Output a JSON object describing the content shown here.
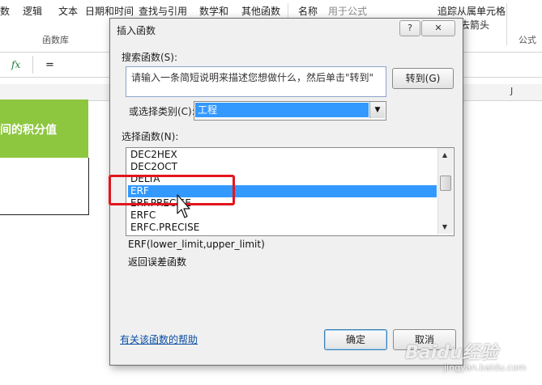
{
  "ribbon": {
    "items": [
      {
        "label": "数"
      },
      {
        "label": "逻辑"
      },
      {
        "label": "文本"
      },
      {
        "label": "日期和时间"
      },
      {
        "label": "查找与引用"
      },
      {
        "label": "数学和"
      },
      {
        "label": "其他函数"
      },
      {
        "label": "名称"
      },
      {
        "label": "用于公式"
      },
      {
        "label": "追踪从属单元格"
      }
    ],
    "group_label": "函数库",
    "right_group_label": "公式",
    "partial_right_label": "移去箭头"
  },
  "formula_bar": {
    "fx": "fx",
    "content": "="
  },
  "columns": {
    "right_header": "J"
  },
  "sheet": {
    "cell_text": "间的积分值",
    "cell_color": "#8dc63f"
  },
  "dialog": {
    "title": "插入函数",
    "help_btn": "?",
    "close_btn": "✕",
    "search_label": "搜索函数(S):",
    "search_value": "请输入一条简短说明来描述您想做什么，然后单击\"转到\"",
    "goto_button": "转到(G)",
    "category_label": "或选择类别(C):",
    "category_value": "工程",
    "dropdown_arrow": "▼",
    "function_label": "选择函数(N):",
    "functions": [
      "DEC2HEX",
      "DEC2OCT",
      "DELTA",
      "ERF",
      "ERF.PRECISE",
      "ERFC",
      "ERFC.PRECISE"
    ],
    "selected_index": 3,
    "scroll_up": "▲",
    "scroll_down": "▼",
    "signature": "ERF(lower_limit,upper_limit)",
    "description": "返回误差函数",
    "help_link": "有关该函数的帮助",
    "ok_button": "确定",
    "cancel_button": "取消"
  },
  "watermark": {
    "text": "Baidu经验",
    "sub": "jingyan.baidu.com"
  },
  "colors": {
    "selection": "#3399ff",
    "highlight_box": "#e3151c",
    "link": "#0b4ea2"
  }
}
